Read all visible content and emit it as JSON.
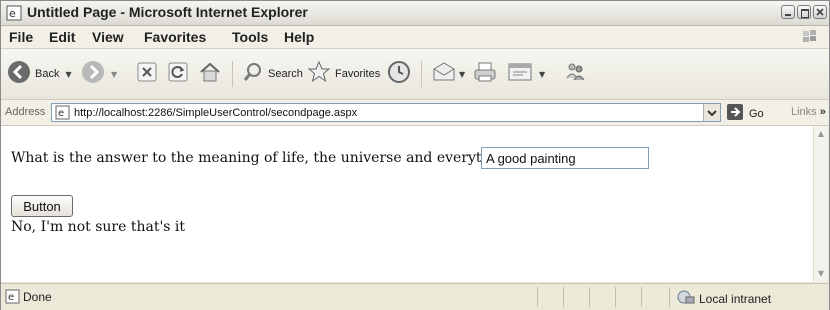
{
  "window": {
    "title": "Untitled Page - Microsoft Internet Explorer"
  },
  "menu": [
    "File",
    "Edit",
    "View",
    "Favorites",
    "Tools",
    "Help"
  ],
  "toolbar": {
    "back_label": "Back",
    "search_label": "Search",
    "favorites_label": "Favorites"
  },
  "address": {
    "label": "Address",
    "url": "http://localhost:2286/SimpleUserControl/secondpage.aspx",
    "go_label": "Go",
    "links_label": "Links"
  },
  "page": {
    "question": "What is the answer to the meaning of life, the universe and everything?",
    "answer_value": "A good painting",
    "button_label": "Button",
    "result_text": "No, I'm not sure that's it"
  },
  "status": {
    "text": "Done",
    "zone": "Local intranet"
  }
}
